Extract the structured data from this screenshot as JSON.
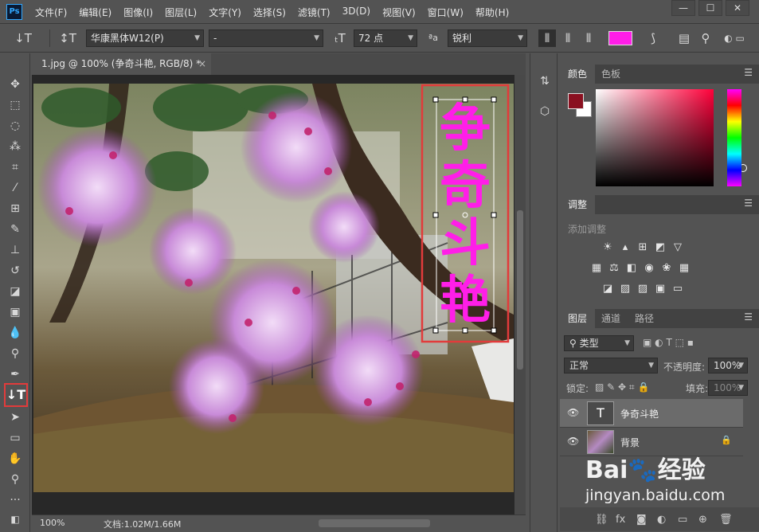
{
  "app": {
    "logo": "Ps",
    "menu": [
      "文件(F)",
      "编辑(E)",
      "图像(I)",
      "图层(L)",
      "文字(Y)",
      "选择(S)",
      "滤镜(T)",
      "3D(D)",
      "视图(V)",
      "窗口(W)",
      "帮助(H)"
    ],
    "window_controls": [
      "—",
      "☐",
      "✕"
    ]
  },
  "options": {
    "font_family": "华康黑体W12(P)",
    "font_style": "-",
    "font_size": "72 点",
    "aa_label": "ªa",
    "antialias": "锐利",
    "text_color": "#ff1ee8"
  },
  "document": {
    "tab_title": "1.jpg @ 100% (争奇斗艳, RGB/8) *",
    "close": "×",
    "text_layer": "争奇斗艳",
    "text_color": "#ff1ee8"
  },
  "status": {
    "zoom": "100%",
    "doc_size": "文档:1.02M/1.66M"
  },
  "panels": {
    "color_tabs": [
      "颜色",
      "色板"
    ],
    "foreground": "#8a1020",
    "background": "#ffffff",
    "adjust_tab": "调整",
    "adjust_hint": "添加调整",
    "layer_tabs": [
      "图层",
      "通道",
      "路径"
    ],
    "filter_kind": "类型",
    "blend_mode": "正常",
    "opacity_label": "不透明度:",
    "opacity": "100%",
    "lock_label": "锁定:",
    "fill_label": "填充:",
    "fill": "100%",
    "layers": [
      {
        "name": "争奇斗艳",
        "thumb": "T"
      },
      {
        "name": "背景"
      }
    ]
  },
  "watermark": {
    "logo": "Bai🐾经验",
    "url": "jingyan.baidu.com"
  }
}
